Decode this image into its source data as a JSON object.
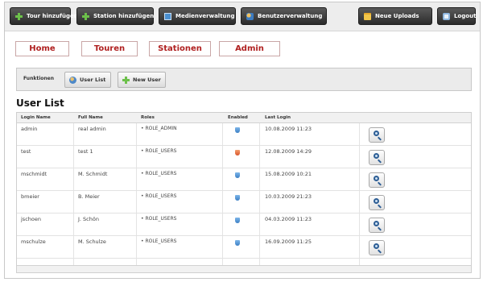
{
  "toolbar": {
    "tour_add": "Tour hinzufügen",
    "station_add": "Station hinzufügen",
    "media": "Medienverwaltung",
    "users": "Benutzerverwaltung",
    "new_uploads": "Neue Uploads",
    "logout": "Logout"
  },
  "nav": {
    "home": "Home",
    "tours": "Touren",
    "stations": "Stationen",
    "admin": "Admin"
  },
  "functions": {
    "label": "Funktionen",
    "user_list": "User List",
    "new_user": "New User"
  },
  "heading": "User List",
  "table": {
    "columns": [
      "Login Name",
      "Full Name",
      "Roles",
      "Enabled",
      "Last Login"
    ],
    "rows": [
      {
        "login": "admin",
        "full_name": "real admin",
        "role": "• ROLE_ADMIN",
        "enabled": true,
        "last_login": "10.08.2009 11:23"
      },
      {
        "login": "test",
        "full_name": "test 1",
        "role": "• ROLE_USERS",
        "enabled": false,
        "last_login": "12.08.2009 14:29"
      },
      {
        "login": "mschmidt",
        "full_name": "M. Schmidt",
        "role": "• ROLE_USERS",
        "enabled": true,
        "last_login": "15.08.2009 10:21"
      },
      {
        "login": "bmeier",
        "full_name": "B. Meier",
        "role": "• ROLE_USERS",
        "enabled": true,
        "last_login": "10.03.2009 21:23"
      },
      {
        "login": "jschoen",
        "full_name": "J. Schön",
        "role": "• ROLE_USERS",
        "enabled": true,
        "last_login": "04.03.2009 11:23"
      },
      {
        "login": "mschulze",
        "full_name": "M. Schulze",
        "role": "• ROLE_USERS",
        "enabled": true,
        "last_login": "16.09.2009 11:25"
      }
    ]
  },
  "colors": {
    "toolbar_button": "#2b2b2b",
    "nav_text": "#b02020",
    "enabled_icon": "#3b7fc4",
    "disabled_icon": "#d9532a"
  }
}
